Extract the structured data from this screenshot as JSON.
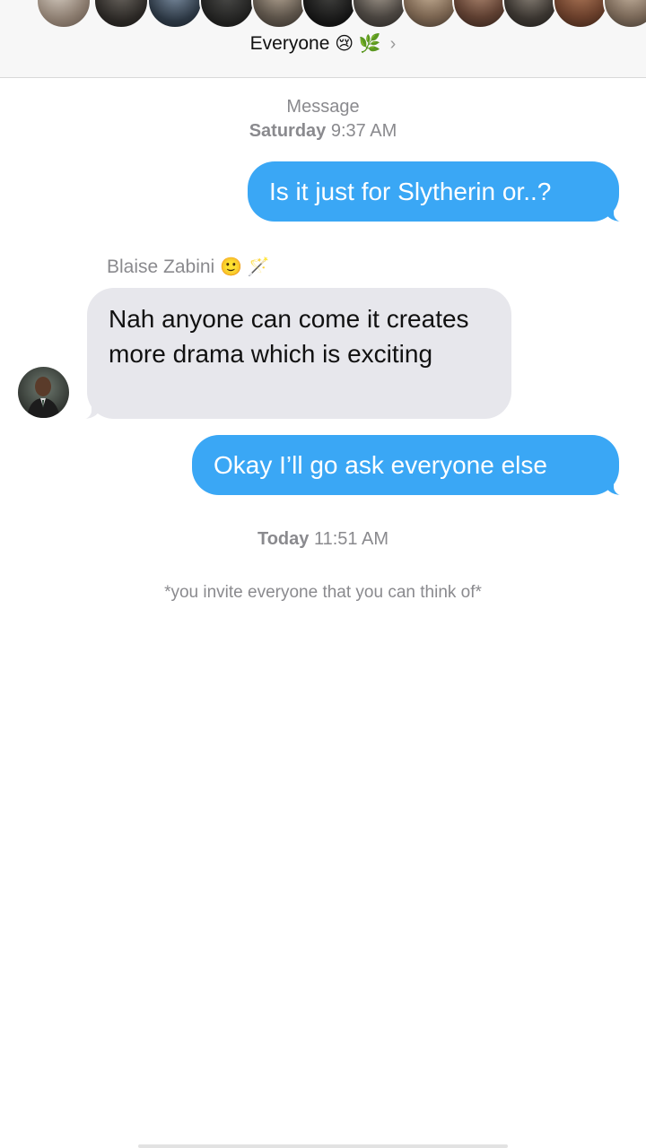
{
  "header": {
    "group_name": "Everyone",
    "group_emoji_1": "😢",
    "group_emoji_2": "🌿",
    "chevron": "›",
    "member_avatar_count": 12
  },
  "conversation": {
    "service_label": "Message",
    "first_stamp_day": "Saturday",
    "first_stamp_time": "9:37 AM",
    "second_stamp_day": "Today",
    "second_stamp_time": "11:51 AM"
  },
  "messages": [
    {
      "direction": "outgoing",
      "text": "Is it just for Slytherin or..?"
    },
    {
      "direction": "incoming",
      "sender": "Blaise Zabini",
      "sender_emoji_1": "🙂",
      "sender_emoji_2": "🪄",
      "text": "Nah anyone can come it creates more drama which is exciting"
    },
    {
      "direction": "outgoing",
      "text": "Okay I’ll go ask everyone else"
    }
  ],
  "narration": "*you invite everyone that you can think of*",
  "colors": {
    "outgoing_bubble": "#3aa7f5",
    "incoming_bubble": "#e7e7ec",
    "meta_text": "#8a8a8e",
    "header_bg": "#f7f7f7"
  }
}
